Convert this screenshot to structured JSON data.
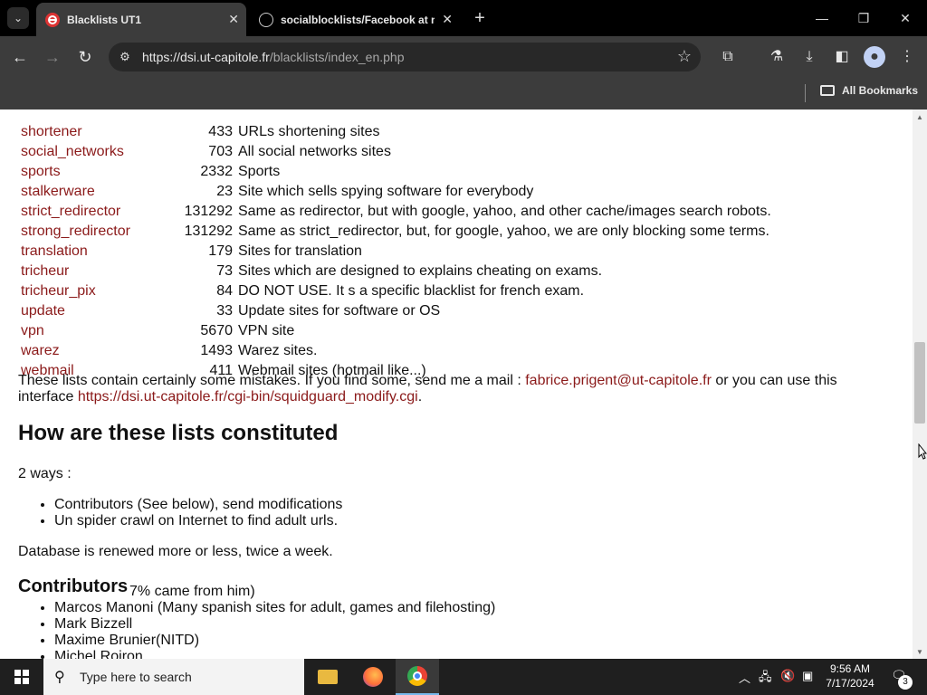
{
  "browser": {
    "tabs": [
      {
        "title": "Blacklists UT1",
        "active": true
      },
      {
        "title": "socialblocklists/Facebook at m",
        "active": false
      }
    ],
    "address_url_host": "https://dsi.ut-capitole.fr",
    "address_url_path": "/blacklists/index_en.php",
    "bookmarks_label": "All Bookmarks"
  },
  "page": {
    "lists": [
      {
        "name": "shortener",
        "count": "433",
        "desc": "URLs shortening sites"
      },
      {
        "name": "social_networks",
        "count": "703",
        "desc": "All social networks sites"
      },
      {
        "name": "sports",
        "count": "2332",
        "desc": "Sports"
      },
      {
        "name": "stalkerware",
        "count": "23",
        "desc": "Site which sells spying software for everybody"
      },
      {
        "name": "strict_redirector",
        "count": "131292",
        "desc": "Same as redirector, but with google, yahoo, and other cache/images search robots."
      },
      {
        "name": "strong_redirector",
        "count": "131292",
        "desc": "Same as strict_redirector, but, for google, yahoo, we are only blocking some terms."
      },
      {
        "name": "translation",
        "count": "179",
        "desc": "Sites for translation"
      },
      {
        "name": "tricheur",
        "count": "73",
        "desc": "Sites which are designed to explains cheating on exams."
      },
      {
        "name": "tricheur_pix",
        "count": "84",
        "desc": "DO NOT USE. It s a specific blacklist for french exam."
      },
      {
        "name": "update",
        "count": "33",
        "desc": "Update sites for software or OS"
      },
      {
        "name": "vpn",
        "count": "5670",
        "desc": "VPN site"
      },
      {
        "name": "warez",
        "count": "1493",
        "desc": "Warez sites."
      },
      {
        "name": "webmail",
        "count": "411",
        "desc": "Webmail sites (hotmail like...)"
      }
    ],
    "mistakes_text_1": "These lists contain certainly some mistakes. If you find some, send me a mail : ",
    "mistakes_email": "fabrice.prigent@ut-capitole.fr",
    "mistakes_text_2": " or you can use this interface ",
    "mistakes_link": "https://dsi.ut-capitole.fr/cgi-bin/squidguard_modify.cgi",
    "mistakes_text_3": ".",
    "how_heading": "How are these lists constituted",
    "ways_intro": "2 ways :",
    "ways": [
      "Contributors (See below), send modifications",
      "Un spider crawl on Internet to find adult urls."
    ],
    "db_renewal": "Database is renewed more or less, twice a week.",
    "contributors_heading": "Contributors",
    "contributors_partial": "7% came from him)",
    "contributors": [
      "Marcos Manoni (Many spanish sites for adult, games and filehosting)",
      "Mark Bizzell",
      "Maxime Brunier(NITD)",
      "Michel Roiron"
    ]
  },
  "taskbar": {
    "search_placeholder": "Type here to search",
    "time": "9:56 AM",
    "date": "7/17/2024",
    "notification_count": "3"
  }
}
